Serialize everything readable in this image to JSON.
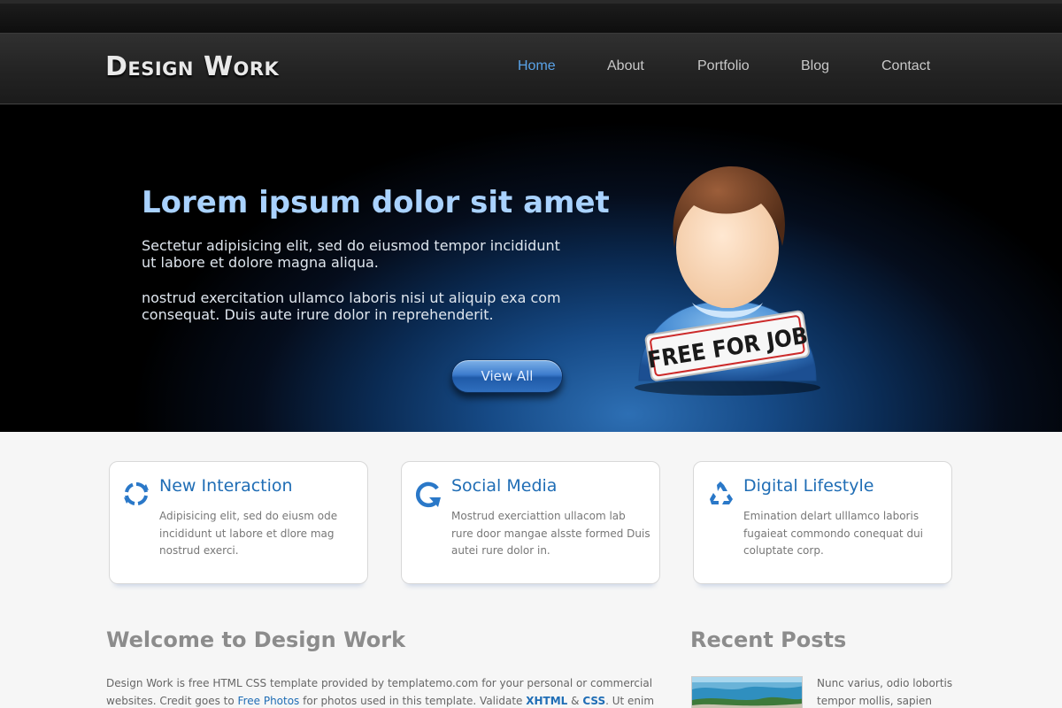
{
  "brand": {
    "logo_text": "Design Work"
  },
  "nav": {
    "items": [
      {
        "label": "Home",
        "active": true
      },
      {
        "label": "About",
        "active": false
      },
      {
        "label": "Portfolio",
        "active": false
      },
      {
        "label": "Blog",
        "active": false
      },
      {
        "label": "Contact",
        "active": false
      }
    ]
  },
  "hero": {
    "title": "Lorem ipsum dolor sit amet",
    "paragraph1": "Sectetur adipisicing elit, sed do eiusmod tempor incididunt ut labore et dolore magna aliqua.",
    "paragraph2": "nostrud exercitation ullamco laboris nisi ut aliquip exa com consequat. Duis aute irure dolor in reprehenderit.",
    "button_label": "View All",
    "badge_text": "FREE FOR JOB"
  },
  "features": [
    {
      "title": "New Interaction",
      "text": "Adipisicing elit, sed do eiusm ode incididunt ut labore et dlore mag nostrud exerci.",
      "icon": "refresh-arrows-icon"
    },
    {
      "title": "Social Media",
      "text": "Mostrud exerciattion ullacom lab rure door mangae alsste formed Duis autei rure dolor in.",
      "icon": "circular-arrow-icon"
    },
    {
      "title": "Digital Lifestyle",
      "text": "Emination delart ulllamco laboris fugaieat commondo conequat dui coluptate corp.",
      "icon": "recycle-icon"
    }
  ],
  "welcome": {
    "title": "Welcome to Design Work",
    "text_part1": "Design Work is free HTML CSS template provided by templatemo.com for your personal or commercial websites. Credit goes to ",
    "link_free_photos": "Free Photos",
    "text_part2": " for photos used in this template. Validate ",
    "link_xhtml": "XHTML",
    "text_amp": " & ",
    "link_css": "CSS",
    "text_part3": ". Ut enim ad"
  },
  "recent_posts": {
    "title": "Recent Posts",
    "items": [
      {
        "text": "Nunc varius, odio lobortis tempor mollis, sapien risus"
      }
    ]
  },
  "colors": {
    "accent": "#1f6db5",
    "nav_active": "#5aa3e8",
    "hero_title": "#a9d2ff"
  }
}
